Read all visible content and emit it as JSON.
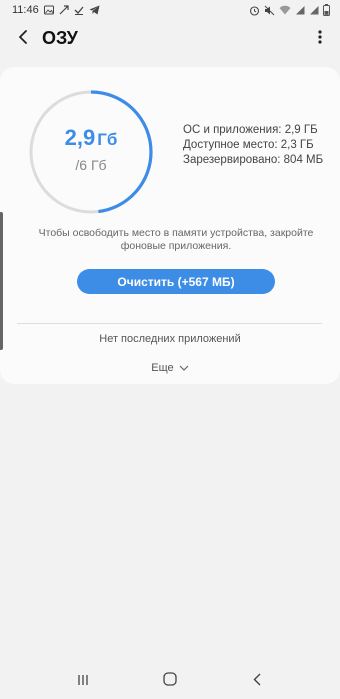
{
  "status_bar": {
    "time": "11:46",
    "left_icons": [
      "gallery-icon",
      "missed-call-icon",
      "check-download-icon",
      "telegram-icon"
    ],
    "right_icons": [
      "alarm-icon",
      "mute-icon",
      "wifi-icon",
      "signal-icon",
      "signal-icon",
      "battery-icon"
    ]
  },
  "header": {
    "title": "ОЗУ",
    "back_icon": "back-arrow-icon",
    "more_icon": "more-vert-icon"
  },
  "memory": {
    "used_value": "2,9",
    "used_unit": "Гб",
    "total": "/6 Гб",
    "used_fraction": 0.48,
    "ring_color": "#3c8ce8",
    "track_color": "#dcdcdc"
  },
  "stats": {
    "os_apps": "ОС и приложения: 2,9 ГБ",
    "available": "Доступное место: 2,3 ГБ",
    "reserved": "Зарезервировано: 804 МБ"
  },
  "hint": {
    "line1": "Чтобы освободить место в памяти устройства, закройте",
    "line2": "фоновые приложения."
  },
  "clean_button": {
    "label": "Очистить (+567 МБ)",
    "color": "#3d8de6"
  },
  "recent": {
    "empty_text": "Нет последних приложений"
  },
  "more": {
    "label": "Еще",
    "icon": "chevron-down-icon"
  },
  "nav": {
    "recents_icon": "recents-icon",
    "home_icon": "home-icon",
    "back_icon": "nav-back-icon"
  }
}
